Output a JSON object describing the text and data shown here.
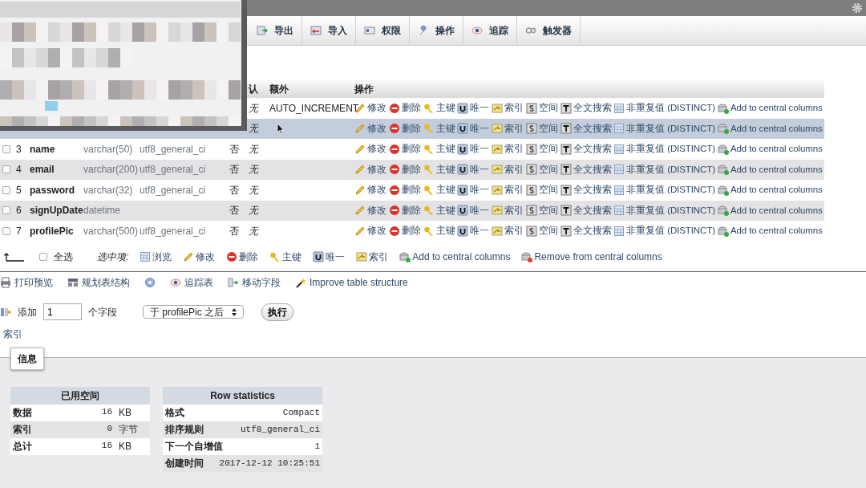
{
  "tabs": [
    {
      "label": "导出",
      "selected": false
    },
    {
      "label": "导入",
      "selected": false
    },
    {
      "label": "权限",
      "selected": false
    },
    {
      "label": "操作",
      "selected": false
    },
    {
      "label": "追踪",
      "selected": false
    },
    {
      "label": "触发器",
      "selected": false
    }
  ],
  "table": {
    "columns": [
      "认",
      "额外",
      "操作"
    ],
    "rows": [
      {
        "default": "无",
        "extra": "AUTO_INCREMENT",
        "highlighted": false,
        "actions": [
          "修改",
          "删除",
          "主键",
          "唯一",
          "索引",
          "空间",
          "全文搜索",
          "非重复值 (DISTINCT)",
          "Add to central columns"
        ]
      },
      {
        "default": "无",
        "highlighted": true,
        "actions": [
          "修改",
          "删除",
          "主键",
          "唯一",
          "索引",
          "空间",
          "全文搜索",
          "非重复值 (DISTINCT)",
          "Add to central columns"
        ]
      },
      {
        "checked": false,
        "number": "3",
        "name": "name",
        "type": "varchar(50)",
        "collation": "utf8_general_ci",
        "null": "否",
        "default": "无",
        "highlighted": false,
        "actions": [
          "修改",
          "删除",
          "主键",
          "唯一",
          "索引",
          "空间",
          "全文搜索",
          "非重复值 (DISTINCT)",
          "Add to central columns"
        ]
      },
      {
        "checked": false,
        "number": "4",
        "name": "email",
        "type": "varchar(200)",
        "collation": "utf8_general_ci",
        "null": "否",
        "default": "无",
        "highlighted": false,
        "actions": [
          "修改",
          "删除",
          "主键",
          "唯一",
          "索引",
          "空间",
          "全文搜索",
          "非重复值 (DISTINCT)",
          "Add to central columns"
        ]
      },
      {
        "checked": false,
        "number": "5",
        "name": "password",
        "type": "varchar(32)",
        "collation": "utf8_general_ci",
        "null": "否",
        "default": "无",
        "highlighted": false,
        "actions": [
          "修改",
          "删除",
          "主键",
          "唯一",
          "索引",
          "空间",
          "全文搜索",
          "非重复值 (DISTINCT)",
          "Add to central columns"
        ]
      },
      {
        "checked": false,
        "number": "6",
        "name": "signUpDate",
        "type": "datetime",
        "null": "否",
        "default": "无",
        "highlighted": false,
        "actions": [
          "修改",
          "删除",
          "主键",
          "唯一",
          "索引",
          "空间",
          "全文搜索",
          "非重复值 (DISTINCT)",
          "Add to central columns"
        ]
      },
      {
        "checked": false,
        "number": "7",
        "name": "profilePic",
        "type": "varchar(500)",
        "collation": "utf8_general_ci",
        "null": "否",
        "default": "无",
        "highlighted": false,
        "actions": [
          "修改",
          "删除",
          "主键",
          "唯一",
          "索引",
          "空间",
          "全文搜索",
          "非重复值 (DISTINCT)",
          "Add to central columns"
        ]
      }
    ]
  },
  "bulk": {
    "select_all": {
      "label": "全选",
      "checked": false
    },
    "with_selected": "选中项:",
    "actions": [
      "浏览",
      "修改",
      "删除",
      "主键",
      "唯一",
      "索引",
      "Add to central columns",
      "Remove from central columns"
    ]
  },
  "links": [
    "打印预览",
    "规划表结构",
    "追踪表",
    "移动字段",
    "Improve table structure"
  ],
  "add_column": {
    "label": "添加",
    "value": "1",
    "unit": "个字段",
    "position": "于 profilePic 之后",
    "button": "执行"
  },
  "index_link": "索引",
  "info_tab": "信息",
  "space_table": {
    "title": "已用空间",
    "rows": [
      {
        "label": "数据",
        "value": "16",
        "unit": "KB"
      },
      {
        "label": "索引",
        "value": "0",
        "unit": "字节"
      },
      {
        "label": "总计",
        "value": "16",
        "unit": "KB"
      }
    ]
  },
  "row_stats": {
    "title": "Row statistics",
    "rows": [
      {
        "label": "格式",
        "value": "Compact"
      },
      {
        "label": "排序规则",
        "value": "utf8_general_ci"
      },
      {
        "label": "下一个自增值",
        "value": "1"
      },
      {
        "label": "创建时间",
        "value": "2017-12-12 10:25:51"
      }
    ]
  }
}
